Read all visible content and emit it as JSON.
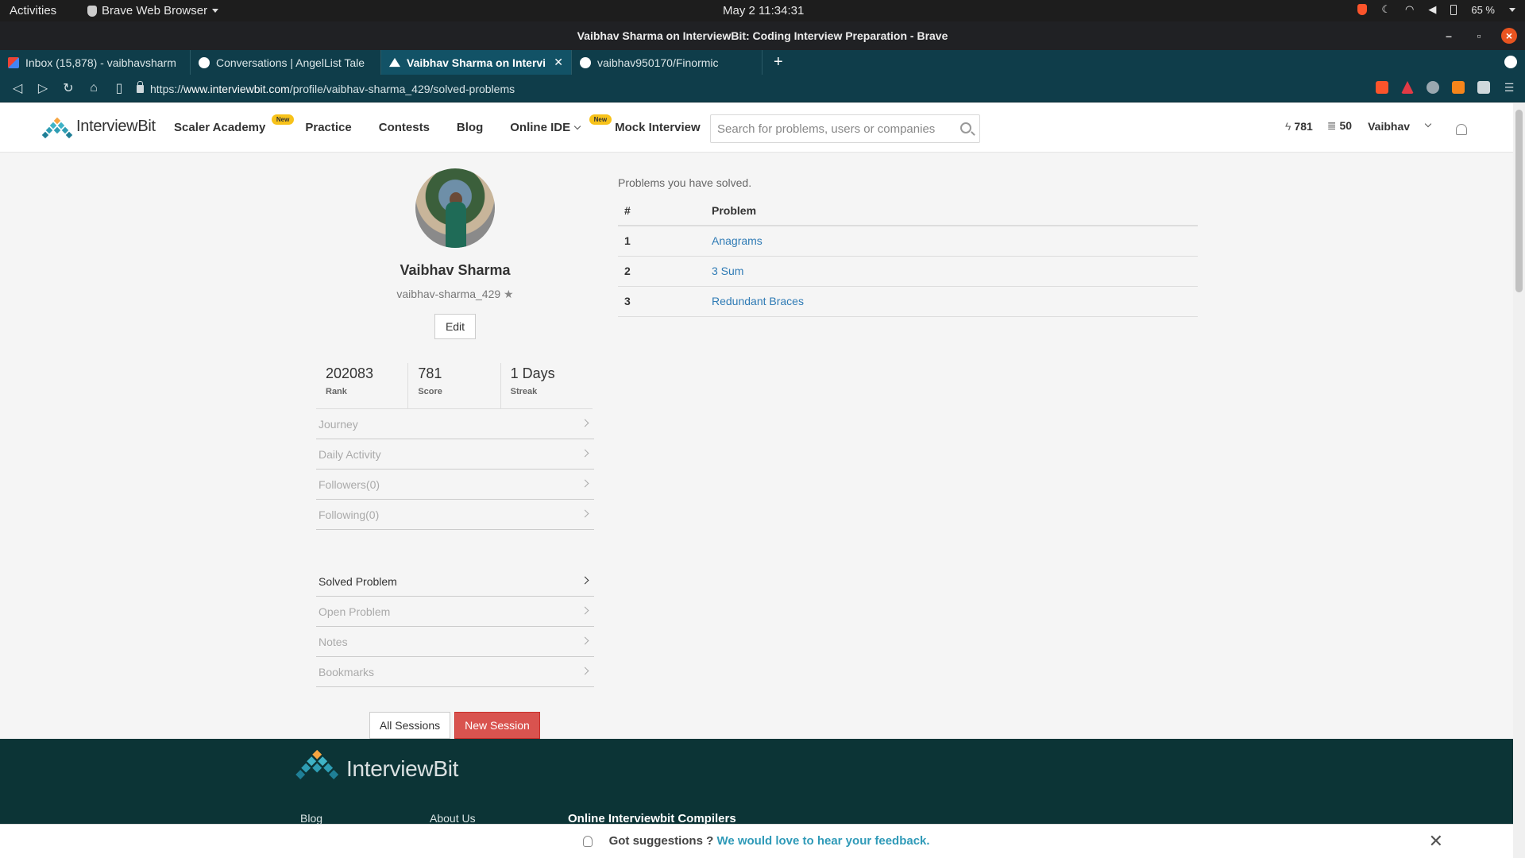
{
  "os": {
    "activities": "Activities",
    "app_name": "Brave Web Browser",
    "clock": "May 2  11:34:31",
    "battery": "65 %"
  },
  "window": {
    "title": "Vaibhav Sharma on InterviewBit: Coding Interview Preparation - Brave"
  },
  "tabs": [
    {
      "label": "Inbox (15,878) - vaibhavsharm",
      "icon": "gmail-icon",
      "active": false
    },
    {
      "label": "Conversations | AngelList Tale",
      "icon": "angellist-icon",
      "active": false
    },
    {
      "label": "Vaibhav Sharma on Intervi",
      "icon": "interviewbit-icon",
      "active": true
    },
    {
      "label": "vaibhav950170/Finormic",
      "icon": "github-icon",
      "active": false
    }
  ],
  "address": {
    "prefix": "https://",
    "domain": "www.interviewbit.com",
    "path": "/profile/vaibhav-sharma_429/solved-problems",
    "shields_count": "3"
  },
  "header": {
    "logo_text": "InterviewBit",
    "nav": [
      {
        "label": "Scaler Academy",
        "badge": "New"
      },
      {
        "label": "Practice"
      },
      {
        "label": "Contests"
      },
      {
        "label": "Blog"
      },
      {
        "label": "Online IDE",
        "badge": "New",
        "dropdown": true
      },
      {
        "label": "Mock Interview"
      }
    ],
    "search_placeholder": "Search for problems, users or companies",
    "score_badge": "781",
    "coins_badge": "50",
    "user_name": "Vaibhav"
  },
  "profile": {
    "name": "Vaibhav Sharma",
    "handle": "vaibhav-sharma_429",
    "edit_label": "Edit",
    "stats": [
      {
        "value": "202083",
        "label": "Rank"
      },
      {
        "value": "781",
        "label": "Score"
      },
      {
        "value": "1 Days",
        "label": "Streak"
      }
    ],
    "menu_primary": [
      "Journey",
      "Daily Activity",
      "Followers(0)",
      "Following(0)"
    ],
    "menu_secondary": [
      {
        "label": "Solved Problem",
        "active": true
      },
      {
        "label": "Open Problem",
        "active": false
      },
      {
        "label": "Notes",
        "active": false
      },
      {
        "label": "Bookmarks",
        "active": false
      }
    ],
    "all_sessions_label": "All Sessions",
    "new_session_label": "New Session"
  },
  "solved": {
    "caption": "Problems you have solved.",
    "columns": [
      "#",
      "Problem"
    ],
    "rows": [
      {
        "num": "1",
        "problem": "Anagrams"
      },
      {
        "num": "2",
        "problem": "3 Sum"
      },
      {
        "num": "3",
        "problem": "Redundant Braces"
      }
    ]
  },
  "footer": {
    "logo_text": "InterviewBit",
    "links": [
      "Blog",
      "About Us"
    ],
    "heading": "Online Interviewbit Compilers"
  },
  "feedback": {
    "prompt": "Got suggestions ?",
    "link": "We would love to hear your feedback."
  },
  "colors": {
    "accent": "#2f7bb5",
    "danger": "#d9534f",
    "footer_bg": "#0c3436",
    "tab_bg": "#0f3d4a"
  }
}
